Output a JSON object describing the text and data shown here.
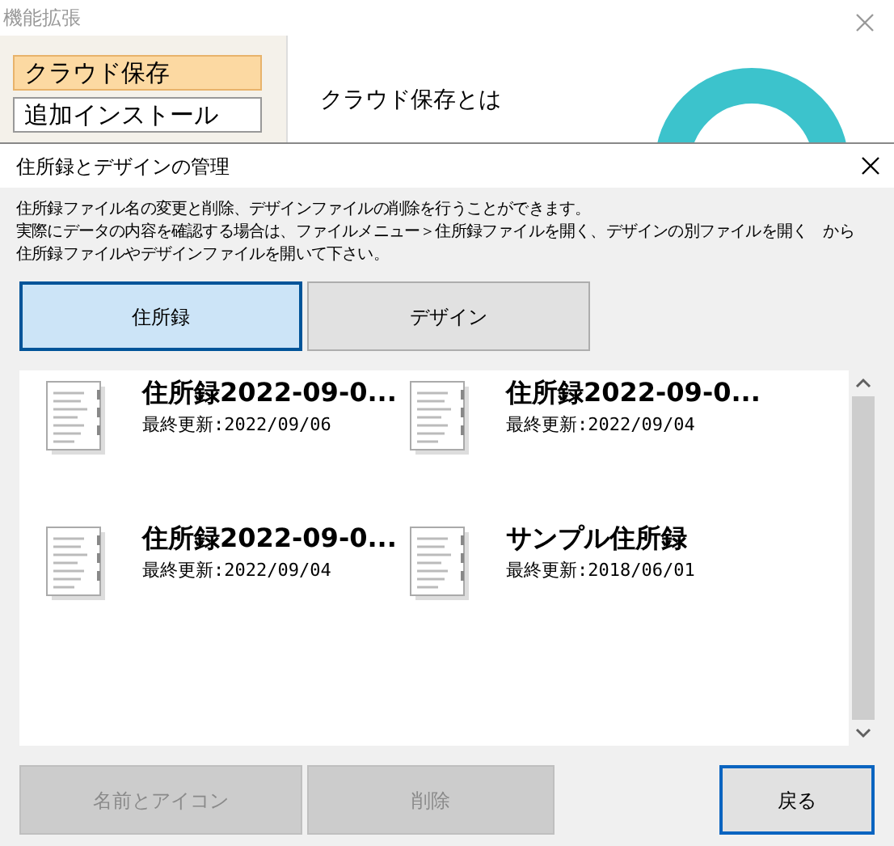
{
  "back_window": {
    "title": "機能拡張",
    "sidebar": {
      "items": [
        {
          "label": "クラウド保存",
          "selected": true
        },
        {
          "label": "追加インストール",
          "selected": false
        }
      ]
    },
    "content_heading": "クラウド保存とは"
  },
  "dialog": {
    "title": "住所録とデザインの管理",
    "description": [
      "住所録ファイル名の変更と削除、デザインファイルの削除を行うことができます。",
      "実際にデータの内容を確認する場合は、ファイルメニュー＞住所録ファイルを開く、デザインの別ファイルを開く　から",
      "住所録ファイルやデザインファイルを開いて下さい。"
    ],
    "tabs": [
      {
        "label": "住所録",
        "selected": true
      },
      {
        "label": "デザイン",
        "selected": false
      }
    ],
    "files": [
      {
        "name": "住所録2022-09-0...",
        "updated": "最終更新:2022/09/06"
      },
      {
        "name": "住所録2022-09-0...",
        "updated": "最終更新:2022/09/04"
      },
      {
        "name": "住所録2022-09-0...",
        "updated": "最終更新:2022/09/04"
      },
      {
        "name": "サンプル住所録",
        "updated": "最終更新:2018/06/01"
      }
    ],
    "buttons": [
      {
        "label": "名前とアイコン",
        "disabled": true,
        "kind": "left"
      },
      {
        "label": "削除",
        "disabled": true,
        "kind": "left"
      },
      {
        "label": "戻る",
        "disabled": false,
        "kind": "right"
      }
    ]
  }
}
